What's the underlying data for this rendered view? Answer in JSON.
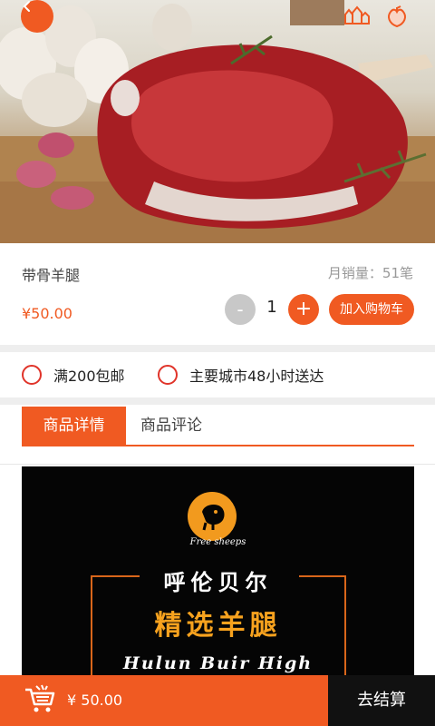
{
  "product": {
    "name": "带骨羊腿",
    "sales_label": "月销量：51笔",
    "price": "¥50.00",
    "quantity": "1",
    "add_to_cart": "加入购物车",
    "minus": "-",
    "plus": "+"
  },
  "services": [
    "满200包邮",
    "主要城市48小时送达"
  ],
  "tabs": {
    "active": "商品详情",
    "inactive": "商品评论"
  },
  "promo": {
    "brand": "Free sheeps",
    "title1": "呼伦贝尔",
    "title2": "精选羊腿",
    "title3": "Hulun Buir High"
  },
  "bottom": {
    "total": "¥ 50.00",
    "checkout": "去结算"
  },
  "colors": {
    "accent": "#f05a22",
    "dark": "#111111",
    "gold": "#f7a21e"
  },
  "icons": {
    "back": "chevron-left-icon",
    "share": "sheep-family-icon",
    "favorite": "peach-icon",
    "cart": "shopping-cart-icon"
  }
}
